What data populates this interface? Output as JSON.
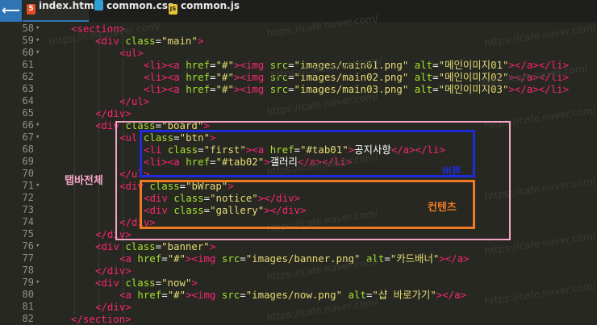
{
  "tabs": [
    {
      "icon": "5",
      "label": "index.html",
      "active": true
    },
    {
      "icon": "",
      "label": "common.css",
      "active": false
    },
    {
      "icon": "JS",
      "label": "common.js",
      "active": false
    }
  ],
  "back_arrow": "⟵",
  "lines": [
    {
      "n": 58,
      "indent": 1,
      "parts": [
        [
          "t",
          "<section>"
        ]
      ]
    },
    {
      "n": 59,
      "indent": 2,
      "parts": [
        [
          "t",
          "<div "
        ],
        [
          "a",
          "class"
        ],
        [
          "p",
          "="
        ],
        [
          "s",
          "\"main\""
        ],
        [
          "t",
          ">"
        ]
      ]
    },
    {
      "n": 60,
      "indent": 3,
      "parts": [
        [
          "t",
          "<ul>"
        ]
      ]
    },
    {
      "n": 61,
      "indent": 4,
      "parts": [
        [
          "t",
          "<li><a "
        ],
        [
          "a",
          "href"
        ],
        [
          "p",
          "="
        ],
        [
          "s",
          "\"#\""
        ],
        [
          "t",
          "><img "
        ],
        [
          "a",
          "src"
        ],
        [
          "p",
          "="
        ],
        [
          "s",
          "\"images/main01.png\""
        ],
        [
          "p",
          " "
        ],
        [
          "a",
          "alt"
        ],
        [
          "p",
          "="
        ],
        [
          "s",
          "\"메인이미지01\""
        ],
        [
          "t",
          "></a></li>"
        ]
      ]
    },
    {
      "n": 62,
      "indent": 4,
      "parts": [
        [
          "t",
          "<li><a "
        ],
        [
          "a",
          "href"
        ],
        [
          "p",
          "="
        ],
        [
          "s",
          "\"#\""
        ],
        [
          "t",
          "><img "
        ],
        [
          "a",
          "src"
        ],
        [
          "p",
          "="
        ],
        [
          "s",
          "\"images/main02.png\""
        ],
        [
          "p",
          " "
        ],
        [
          "a",
          "alt"
        ],
        [
          "p",
          "="
        ],
        [
          "s",
          "\"메인이미지02\""
        ],
        [
          "t",
          "></a></li>"
        ]
      ]
    },
    {
      "n": 63,
      "indent": 4,
      "parts": [
        [
          "t",
          "<li><a "
        ],
        [
          "a",
          "href"
        ],
        [
          "p",
          "="
        ],
        [
          "s",
          "\"#\""
        ],
        [
          "t",
          "><img "
        ],
        [
          "a",
          "src"
        ],
        [
          "p",
          "="
        ],
        [
          "s",
          "\"images/main03.png\""
        ],
        [
          "p",
          " "
        ],
        [
          "a",
          "alt"
        ],
        [
          "p",
          "="
        ],
        [
          "s",
          "\"메인이미지03\""
        ],
        [
          "t",
          "></a></li>"
        ]
      ]
    },
    {
      "n": 64,
      "indent": 3,
      "parts": [
        [
          "t",
          "</ul>"
        ]
      ]
    },
    {
      "n": 65,
      "indent": 2,
      "parts": [
        [
          "t",
          "</div>"
        ]
      ]
    },
    {
      "n": 66,
      "indent": 2,
      "parts": [
        [
          "t",
          "<div "
        ],
        [
          "a",
          "class"
        ],
        [
          "p",
          "="
        ],
        [
          "s",
          "\"board\""
        ],
        [
          "t",
          ">"
        ]
      ]
    },
    {
      "n": 67,
      "indent": 3,
      "parts": [
        [
          "t",
          "<ul "
        ],
        [
          "a",
          "class"
        ],
        [
          "p",
          "="
        ],
        [
          "s",
          "\"btn\""
        ],
        [
          "t",
          ">"
        ]
      ]
    },
    {
      "n": 68,
      "indent": 4,
      "parts": [
        [
          "t",
          "<li "
        ],
        [
          "a",
          "class"
        ],
        [
          "p",
          "="
        ],
        [
          "s",
          "\"first\""
        ],
        [
          "t",
          "><a "
        ],
        [
          "a",
          "href"
        ],
        [
          "p",
          "="
        ],
        [
          "s",
          "\"#tab01\""
        ],
        [
          "t",
          ">"
        ],
        [
          "k",
          "공지사항"
        ],
        [
          "t",
          "</a></li>"
        ]
      ]
    },
    {
      "n": 69,
      "indent": 4,
      "parts": [
        [
          "t",
          "<li><a "
        ],
        [
          "a",
          "href"
        ],
        [
          "p",
          "="
        ],
        [
          "s",
          "\"#tab02\""
        ],
        [
          "t",
          ">"
        ],
        [
          "k",
          "갤러리"
        ],
        [
          "t",
          "</a></li>"
        ]
      ]
    },
    {
      "n": 70,
      "indent": 3,
      "parts": [
        [
          "t",
          "</ul>"
        ]
      ]
    },
    {
      "n": 71,
      "indent": 3,
      "parts": [
        [
          "t",
          "<div "
        ],
        [
          "a",
          "class"
        ],
        [
          "p",
          "="
        ],
        [
          "s",
          "\"bWrap\""
        ],
        [
          "t",
          ">"
        ]
      ]
    },
    {
      "n": 72,
      "indent": 4,
      "parts": [
        [
          "t",
          "<div "
        ],
        [
          "a",
          "class"
        ],
        [
          "p",
          "="
        ],
        [
          "s",
          "\"notice\""
        ],
        [
          "t",
          "></div>"
        ]
      ]
    },
    {
      "n": 73,
      "indent": 4,
      "parts": [
        [
          "t",
          "<div "
        ],
        [
          "a",
          "class"
        ],
        [
          "p",
          "="
        ],
        [
          "s",
          "\"gallery\""
        ],
        [
          "t",
          "></div>"
        ]
      ]
    },
    {
      "n": 74,
      "indent": 3,
      "parts": [
        [
          "t",
          "</div>"
        ]
      ]
    },
    {
      "n": 75,
      "indent": 2,
      "parts": [
        [
          "t",
          "</div>"
        ]
      ]
    },
    {
      "n": 76,
      "indent": 2,
      "parts": [
        [
          "t",
          "<div "
        ],
        [
          "a",
          "class"
        ],
        [
          "p",
          "="
        ],
        [
          "s",
          "\"banner\""
        ],
        [
          "t",
          ">"
        ]
      ]
    },
    {
      "n": 77,
      "indent": 3,
      "parts": [
        [
          "t",
          "<a "
        ],
        [
          "a",
          "href"
        ],
        [
          "p",
          "="
        ],
        [
          "s",
          "\"#\""
        ],
        [
          "t",
          "><img "
        ],
        [
          "a",
          "src"
        ],
        [
          "p",
          "="
        ],
        [
          "s",
          "\"images/banner.png\""
        ],
        [
          "p",
          " "
        ],
        [
          "a",
          "alt"
        ],
        [
          "p",
          "="
        ],
        [
          "s",
          "\"카드배너\""
        ],
        [
          "t",
          "></a>"
        ]
      ]
    },
    {
      "n": 78,
      "indent": 2,
      "parts": [
        [
          "t",
          "</div>"
        ]
      ]
    },
    {
      "n": 79,
      "indent": 2,
      "parts": [
        [
          "t",
          "<div "
        ],
        [
          "a",
          "class"
        ],
        [
          "p",
          "="
        ],
        [
          "s",
          "\"now\""
        ],
        [
          "t",
          ">"
        ]
      ]
    },
    {
      "n": 80,
      "indent": 3,
      "parts": [
        [
          "t",
          "<a "
        ],
        [
          "a",
          "href"
        ],
        [
          "p",
          "="
        ],
        [
          "s",
          "\"#\""
        ],
        [
          "t",
          "><img "
        ],
        [
          "a",
          "src"
        ],
        [
          "p",
          "="
        ],
        [
          "s",
          "\"images/now.png\""
        ],
        [
          "p",
          " "
        ],
        [
          "a",
          "alt"
        ],
        [
          "p",
          "="
        ],
        [
          "s",
          "\"샵 바로가기\""
        ],
        [
          "t",
          "></a>"
        ]
      ]
    },
    {
      "n": 81,
      "indent": 2,
      "parts": [
        [
          "t",
          "</div>"
        ]
      ]
    },
    {
      "n": 82,
      "indent": 1,
      "parts": [
        [
          "t",
          "</section>"
        ]
      ]
    }
  ],
  "fold_lines": [
    58,
    59,
    60,
    66,
    67,
    71,
    76,
    79
  ],
  "annotations": {
    "board_label": "탭바전체",
    "btn_label": "버튼",
    "content_label": "컨텐츠",
    "colors": {
      "board": "#f4a6c8",
      "btn": "#1f2bd8",
      "content": "#f07a24"
    }
  },
  "watermark": "https://cafe.naver.com/"
}
